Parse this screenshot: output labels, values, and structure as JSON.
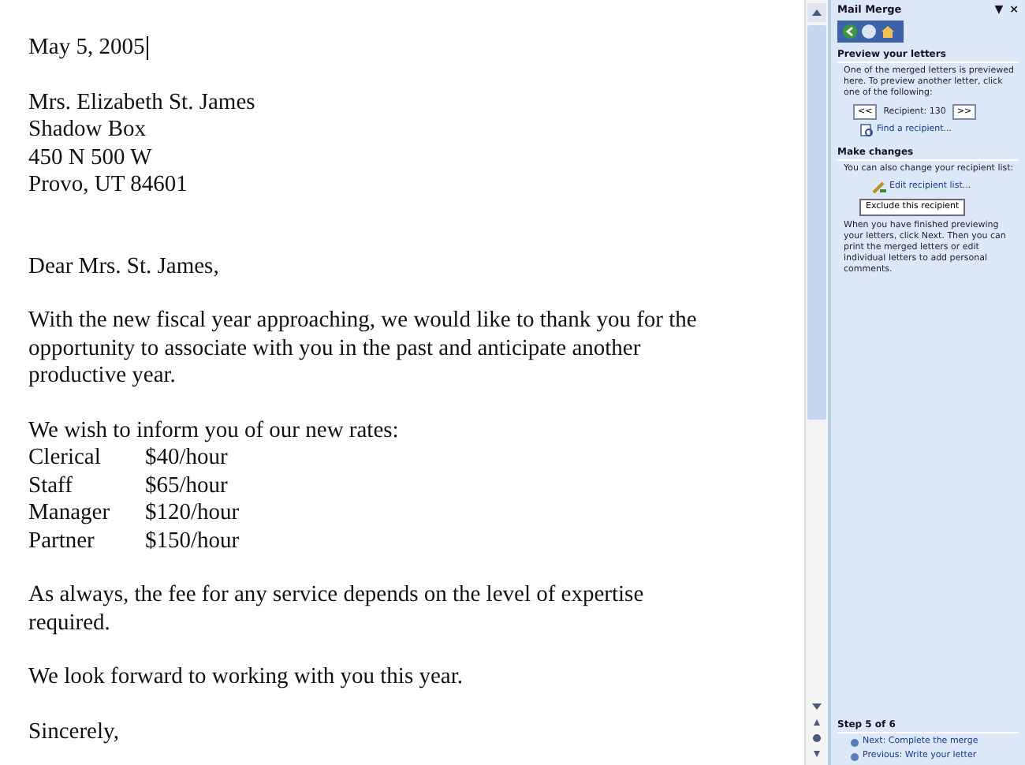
{
  "document": {
    "blocks": [
      {
        "kind": "lines",
        "lines": [
          "May 5, 2005"
        ],
        "cursor": true
      },
      {
        "kind": "lines",
        "lines": [
          "Mrs. Elizabeth St. James",
          "Shadow Box",
          "450 N 500 W",
          "Provo, UT 84601"
        ]
      },
      {
        "kind": "gap"
      },
      {
        "kind": "lines",
        "lines": [
          "Dear Mrs. St. James,"
        ]
      },
      {
        "kind": "paragraph",
        "text": "With the new fiscal year approaching, we would like to thank you for the opportunity to associate with you in the past and anticipate another productive year."
      },
      {
        "kind": "rates",
        "intro": "We wish to inform you of our new rates:",
        "rows": [
          {
            "role": "Clerical",
            "rate": "$40/hour"
          },
          {
            "role": "Staff",
            "rate": "$65/hour"
          },
          {
            "role": "Manager",
            "rate": "$120/hour"
          },
          {
            "role": "Partner",
            "rate": "$150/hour"
          }
        ]
      },
      {
        "kind": "paragraph",
        "text": "As always, the fee for any service depends on the level of expertise required."
      },
      {
        "kind": "lines",
        "lines": [
          "We look forward to working with you this year."
        ]
      },
      {
        "kind": "lines",
        "lines": [
          "Sincerely,"
        ]
      }
    ]
  },
  "task_pane": {
    "title": "Mail Merge",
    "menu_glyph": "▼",
    "close_glyph": "×",
    "preview": {
      "heading": "Preview your letters",
      "text": "One of the merged letters is previewed here. To preview another letter, click one of the following:",
      "prev_button": "<<",
      "recipient": "Recipient: 130",
      "next_button": ">>",
      "find_link": "Find a recipient..."
    },
    "changes": {
      "heading": "Make changes",
      "text": "You can also change your recipient list:",
      "edit_link": "Edit recipient list...",
      "exclude_button": "Exclude this recipient",
      "note": "When you have finished previewing your letters, click Next. Then you can print the merged letters or edit individual letters to add personal comments."
    },
    "step": {
      "heading": "Step 5 of 6",
      "links": [
        "Next: Complete the merge",
        "Previous: Write your letter"
      ]
    }
  }
}
